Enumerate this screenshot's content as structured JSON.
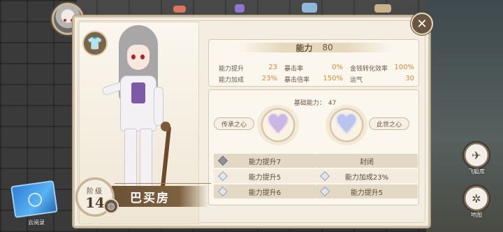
{
  "character": {
    "name": "巴买房",
    "level_label": "阶级",
    "level": "14"
  },
  "stats": {
    "power_label": "能力",
    "power_value": "80",
    "rows": [
      [
        {
          "label": "能力提升",
          "value": "23"
        },
        {
          "label": "暴击率",
          "value": "0%"
        },
        {
          "label": "金钱转化效率",
          "value": "100%"
        }
      ],
      [
        {
          "label": "能力加成",
          "value": "23%"
        },
        {
          "label": "暴击倍率",
          "value": "150%"
        },
        {
          "label": "运气",
          "value": "30"
        }
      ]
    ]
  },
  "base_power": {
    "label": "基础能力：",
    "value": "47"
  },
  "hearts": {
    "left_label": "传承之心",
    "right_label": "此世之心"
  },
  "bonuses": {
    "left": [
      "能力提升7",
      "能力提升5",
      "能力提升6"
    ],
    "right": [
      "封闭",
      "能力加成23%",
      "能力提升5"
    ]
  },
  "side_buttons": {
    "airship_label": "飞艇库",
    "map_label": "地图"
  },
  "bottom_left": {
    "book_label": "云阅录"
  },
  "icons": {
    "close": "close-icon",
    "shirt": "shirt-icon",
    "ring": "ring-icon",
    "airship": "airship-icon",
    "map": "map-icon",
    "book": "book-icon",
    "gem": "gem-icon"
  },
  "colors": {
    "accent_orange": "#d38b31",
    "panel_bg": "#f4eee2",
    "brown": "#6a5640"
  }
}
